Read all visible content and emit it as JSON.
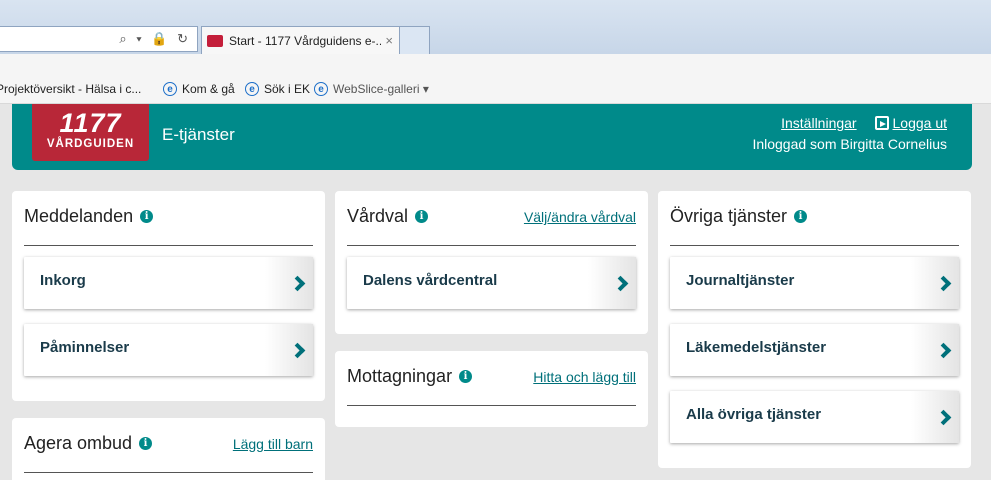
{
  "browser": {
    "tab_title": "Start - 1177 Vårdguidens e-...",
    "tab_close": "×",
    "address_icons": "⌕ ▾ 🔒 ↻",
    "favorites": [
      {
        "label": "Projektöversikt - Hälsa i c..."
      },
      {
        "label": "Kom & gå"
      },
      {
        "label": "Sök i EK"
      },
      {
        "label": "WebSlice-galleri ▾"
      }
    ]
  },
  "header": {
    "logo_number": "1177",
    "logo_sub": "VÅRDGUIDEN",
    "app_name": "E-tjänster",
    "settings_link": "Inställningar",
    "logout_link": "Logga ut",
    "logged_in_as": "Inloggad som Birgitta Cornelius",
    "brand_color": "#008a8a",
    "logo_color": "#b82738"
  },
  "cards": {
    "meddelanden": {
      "title": "Meddelanden",
      "items": [
        {
          "label": "Inkorg"
        },
        {
          "label": "Påminnelser"
        }
      ]
    },
    "agera": {
      "title": "Agera ombud",
      "link": "Lägg till barn"
    },
    "vardval": {
      "title": "Vårdval",
      "link": "Välj/ändra vårdval",
      "items": [
        {
          "label": "Dalens vårdcentral"
        }
      ]
    },
    "mottagningar": {
      "title": "Mottagningar",
      "link": "Hitta och lägg till"
    },
    "ovriga": {
      "title": "Övriga tjänster",
      "items": [
        {
          "label": "Journaltjänster"
        },
        {
          "label": "Läkemedelstjänster"
        },
        {
          "label": "Alla övriga tjänster"
        }
      ]
    }
  }
}
